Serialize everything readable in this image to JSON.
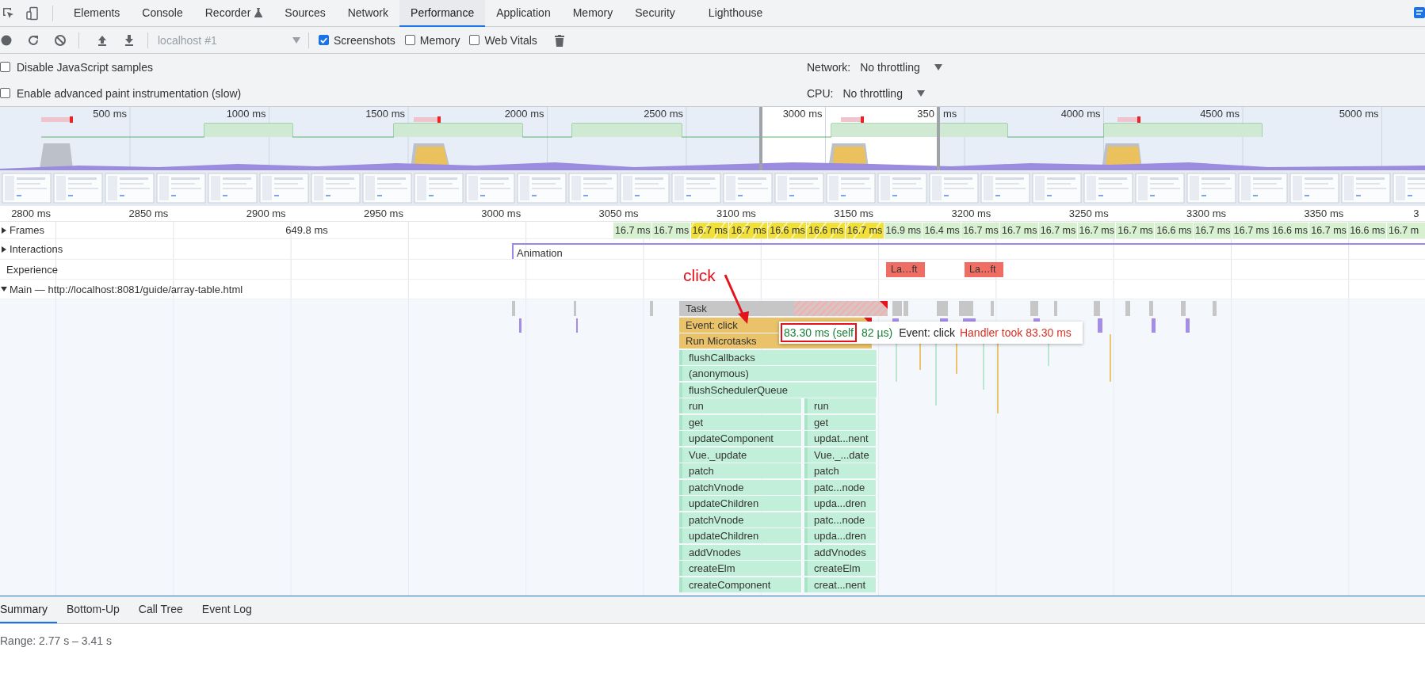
{
  "tabs": [
    {
      "label": "Elements",
      "selected": false,
      "experimental": false
    },
    {
      "label": "Console",
      "selected": false,
      "experimental": false
    },
    {
      "label": "Recorder",
      "selected": false,
      "experimental": true
    },
    {
      "label": "Sources",
      "selected": false,
      "experimental": false
    },
    {
      "label": "Network",
      "selected": false,
      "experimental": false
    },
    {
      "label": "Performance",
      "selected": true,
      "experimental": false
    },
    {
      "label": "Application",
      "selected": false,
      "experimental": false
    },
    {
      "label": "Memory",
      "selected": false,
      "experimental": false
    },
    {
      "label": "Security",
      "selected": false,
      "experimental": false
    },
    {
      "label": "Lighthouse",
      "selected": false,
      "experimental": false
    }
  ],
  "toolbar": {
    "target": "localhost #1",
    "target_disabled": true,
    "options": [
      {
        "label": "Screenshots",
        "checked": true
      },
      {
        "label": "Memory",
        "checked": false
      },
      {
        "label": "Web Vitals",
        "checked": false
      }
    ]
  },
  "settings": {
    "options": [
      {
        "label": "Disable JavaScript samples",
        "checked": false
      },
      {
        "label": "Enable advanced paint instrumentation (slow)",
        "checked": false
      }
    ],
    "throttling": [
      {
        "label": "Network:",
        "value": "No throttling"
      },
      {
        "label": "CPU:",
        "value": "No throttling"
      }
    ]
  },
  "overview": {
    "ticks": [
      "500 ms",
      "1000 ms",
      "1500 ms",
      "2000 ms",
      "2500 ms",
      "3000 ms",
      "350",
      "4000 ms",
      "4500 ms",
      "5000 ms"
    ],
    "handle_suffix": "ms"
  },
  "ruler": [
    "2800 ms",
    "2850 ms",
    "2900 ms",
    "2950 ms",
    "3000 ms",
    "3050 ms",
    "3100 ms",
    "3150 ms",
    "3200 ms",
    "3250 ms",
    "3300 ms",
    "3350 ms",
    "3"
  ],
  "frames": {
    "label": "Frames",
    "expanded": false,
    "long_frame": "649.8 ms",
    "items": [
      {
        "duration": "16.7 ms",
        "partial": false
      },
      {
        "duration": "16.7 ms",
        "partial": false
      },
      {
        "duration": "16.7 ms",
        "partial": true
      },
      {
        "duration": "16.7 ms",
        "partial": true
      },
      {
        "duration": "16.6 ms",
        "partial": true
      },
      {
        "duration": "16.6 ms",
        "partial": true
      },
      {
        "duration": "16.7 ms",
        "partial": true
      },
      {
        "duration": "16.9 ms",
        "partial": false
      },
      {
        "duration": "16.4 ms",
        "partial": false
      },
      {
        "duration": "16.7 ms",
        "partial": false
      },
      {
        "duration": "16.7 ms",
        "partial": false
      },
      {
        "duration": "16.7 ms",
        "partial": false
      },
      {
        "duration": "16.7 ms",
        "partial": false
      },
      {
        "duration": "16.7 ms",
        "partial": false
      },
      {
        "duration": "16.6 ms",
        "partial": false
      },
      {
        "duration": "16.7 ms",
        "partial": false
      },
      {
        "duration": "16.7 ms",
        "partial": false
      },
      {
        "duration": "16.6 ms",
        "partial": false
      },
      {
        "duration": "16.7 ms",
        "partial": false
      },
      {
        "duration": "16.6 ms",
        "partial": false
      },
      {
        "duration": "16.7 m",
        "partial": false
      }
    ]
  },
  "interactions": {
    "label": "Interactions",
    "expanded": false,
    "items": [
      "Animation"
    ]
  },
  "experience": {
    "label": "Experience",
    "shifts": [
      "La…ft",
      "La…ft"
    ]
  },
  "main": {
    "label": "Main — http://localhost:8081/guide/array-table.html",
    "expanded": true,
    "rows": [
      {
        "kind": "task",
        "long": true,
        "items": [
          "Task"
        ]
      },
      {
        "kind": "event",
        "long": true,
        "items": [
          "Event: click"
        ]
      },
      {
        "kind": "event",
        "items": [
          "Run Microtasks"
        ]
      },
      {
        "kind": "script",
        "long": false,
        "items": [
          "flushCallbacks"
        ]
      },
      {
        "kind": "script",
        "long": false,
        "items": [
          "(anonymous)"
        ]
      },
      {
        "kind": "script",
        "long": false,
        "items": [
          "flushSchedulerQueue"
        ]
      },
      {
        "kind": "script",
        "long": false,
        "items": [
          "run",
          "run"
        ]
      },
      {
        "kind": "script",
        "long": false,
        "items": [
          "get",
          "get"
        ]
      },
      {
        "kind": "script",
        "long": false,
        "items": [
          "updateComponent",
          "updat...nent"
        ]
      },
      {
        "kind": "script",
        "long": false,
        "items": [
          "Vue._update",
          "Vue._...date"
        ]
      },
      {
        "kind": "script",
        "long": false,
        "items": [
          "patch",
          "patch"
        ]
      },
      {
        "kind": "script",
        "long": false,
        "items": [
          "patchVnode",
          "patc...node"
        ]
      },
      {
        "kind": "script",
        "long": false,
        "items": [
          "updateChildren",
          "upda...dren"
        ]
      },
      {
        "kind": "script",
        "long": false,
        "items": [
          "patchVnode",
          "patc...node"
        ]
      },
      {
        "kind": "script",
        "long": false,
        "items": [
          "updateChildren",
          "upda...dren"
        ]
      },
      {
        "kind": "script",
        "long": false,
        "items": [
          "addVnodes",
          "addVnodes"
        ]
      },
      {
        "kind": "script",
        "long": false,
        "items": [
          "createElm",
          "createElm"
        ]
      },
      {
        "kind": "script",
        "long": false,
        "items": [
          "createComponent",
          "creat...nent"
        ]
      }
    ]
  },
  "tooltip": {
    "duration": "83.30 ms (self",
    "self": "82 µs)",
    "event": "Event: click",
    "warning": "Handler took 83.30 ms"
  },
  "annotation": {
    "label": "click"
  },
  "bottom_tabs": [
    {
      "label": "Summary",
      "selected": true
    },
    {
      "label": "Bottom-Up",
      "selected": false
    },
    {
      "label": "Call Tree",
      "selected": false
    },
    {
      "label": "Event Log",
      "selected": false
    }
  ],
  "range": "Range: 2.77 s – 3.41 s"
}
